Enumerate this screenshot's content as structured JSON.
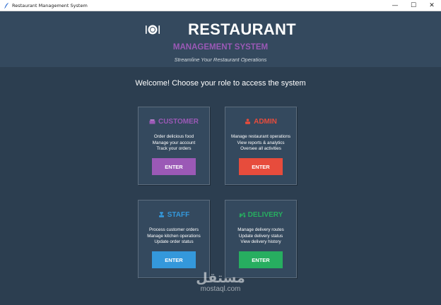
{
  "window": {
    "title": "Restaurant Management System",
    "minimize": "—",
    "maximize": "☐",
    "close": "✕"
  },
  "header": {
    "title": "RESTAURANT",
    "subtitle": "MANAGEMENT SYSTEM",
    "tagline": "Streamline Your Restaurant Operations",
    "icon": "plate-icon"
  },
  "welcome": "Welcome! Choose your role to access the system",
  "roles": [
    {
      "name": "CUSTOMER",
      "icon": "food-icon",
      "color": "#9b59b6",
      "lines": [
        "Order delicious food",
        "Manage your account",
        "Track your orders"
      ],
      "button": "ENTER"
    },
    {
      "name": "ADMIN",
      "icon": "admin-icon",
      "color": "#e74c3c",
      "lines": [
        "Manage restaurant operations",
        "View reports & analytics",
        "Oversee all activities"
      ],
      "button": "ENTER"
    },
    {
      "name": "STAFF",
      "icon": "staff-icon",
      "color": "#3498db",
      "lines": [
        "Process customer orders",
        "Manage kitchen operations",
        "Update order status"
      ],
      "button": "ENTER"
    },
    {
      "name": "DELIVERY",
      "icon": "scooter-icon",
      "color": "#27ae60",
      "lines": [
        "Manage delivery routes",
        "Update delivery status",
        "View delivery history"
      ],
      "button": "ENTER"
    }
  ],
  "watermark": {
    "arabic": "مستقل",
    "latin": "mostaql.com"
  },
  "colors": {
    "background": "#2c3e50",
    "header": "#34495e",
    "card": "#34495e"
  }
}
